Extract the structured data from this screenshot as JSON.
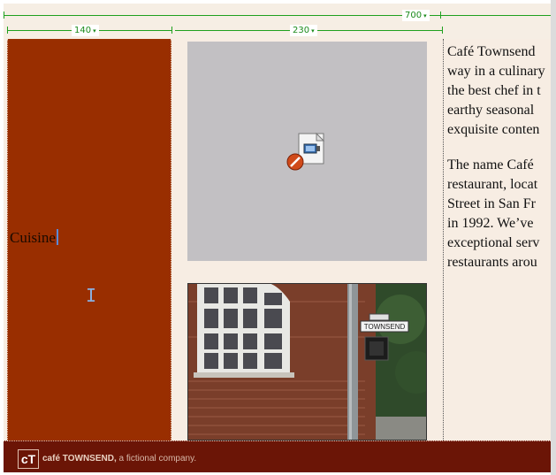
{
  "ruler": {
    "total_width_label": "700",
    "col1_width_label": "140",
    "col2_width_label": "230",
    "caret": "▾"
  },
  "sidebar": {
    "text": "Cuisine"
  },
  "media": {
    "icon": "plugin-media-icon",
    "placeholder_color": "#c2c0c3"
  },
  "photo": {
    "street_sign": "TOWNSEND"
  },
  "article": {
    "para1": "Café Townsend\nway in a culinary\nthe best chef in t\nearthy seasonal\nexquisite conten",
    "para2": "The name Café\nrestaurant, locat\nStreet in San Fr\nin 1992. We’ve\nexceptional serv\nrestaurants arou"
  },
  "footer": {
    "logo_text": "cT",
    "brand": "café TOWNSEND,",
    "tagline": " a fictional company."
  },
  "colors": {
    "sidebar": "#992e00",
    "footer": "#6b1506",
    "ruler_green": "#1ea01e",
    "page_bg": "#f7ede3"
  }
}
